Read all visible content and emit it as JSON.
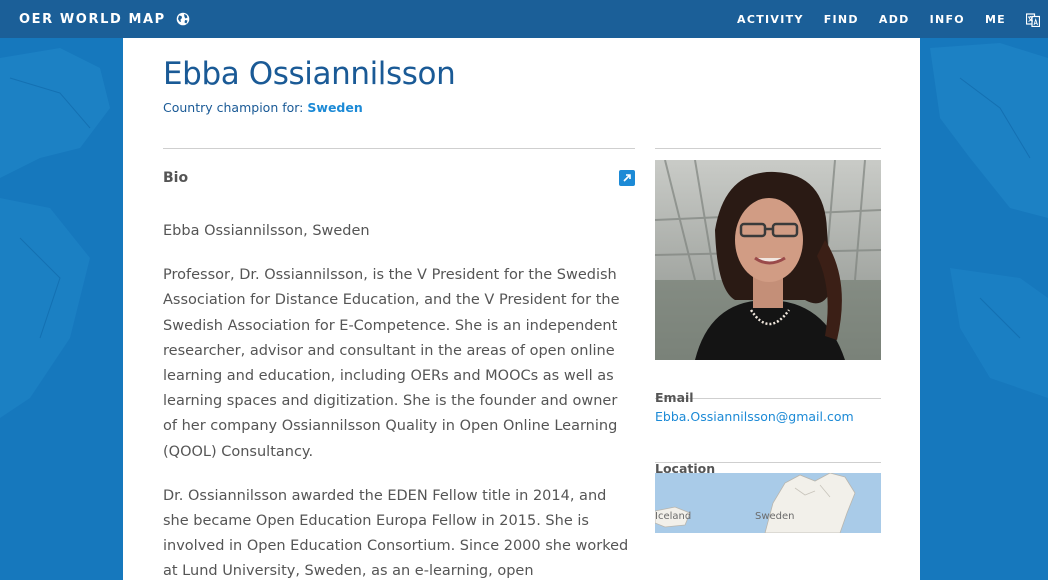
{
  "header": {
    "brand": "OER WORLD MAP",
    "nav": [
      "ACTIVITY",
      "FIND",
      "ADD",
      "INFO",
      "ME"
    ],
    "icons": {
      "brand": "globe-icon",
      "language": "language-icon"
    }
  },
  "profile": {
    "name": "Ebba Ossiannilsson",
    "champion_prefix": "Country champion for:",
    "champion_country": "Sweden"
  },
  "bio": {
    "heading": "Bio",
    "paragraphs": [
      "Ebba Ossiannilsson, Sweden",
      "Professor, Dr. Ossiannilsson, is the V President for the Swedish Association for Distance Education, and the V President for the Swedish Association for E-Competence. She is an independent researcher, advisor and consultant in the areas of open online learning and education, including OERs and MOOCs as well as learning spaces and digitization. She is the founder and owner of her company Ossiannilsson Quality in Open Online Learning (QOOL) Consultancy.",
      "Dr. Ossiannilsson awarded the EDEN Fellow title in 2014, and she became Open Education Europa Fellow in 2015. She is involved in Open Education Consortium. Since 2000 she worked at Lund University, Sweden, as an e-learning, open"
    ]
  },
  "sidebar": {
    "email_label": "Email",
    "email": "Ebba.Ossiannilsson@gmail.com",
    "location_label": "Location",
    "map_labels": [
      "Iceland",
      "Sweden"
    ]
  },
  "colors": {
    "topbar": "#1b5f98",
    "title": "#1a5a96",
    "link": "#1c8ad6",
    "map_water": "#1678bd"
  }
}
